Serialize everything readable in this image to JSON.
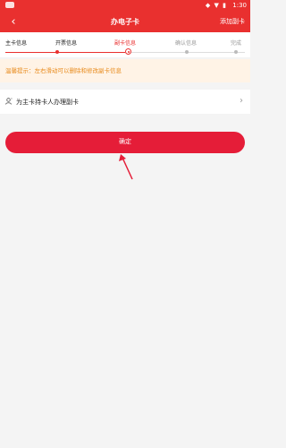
{
  "status_bar": {
    "time": "1:30",
    "icons": "◆ ▼ ▮"
  },
  "header": {
    "back_icon": "‹",
    "title": "办电子卡",
    "action_label": "添加副卡"
  },
  "steps": [
    {
      "label": "主卡信息",
      "state": "done"
    },
    {
      "label": "开票信息",
      "state": "done"
    },
    {
      "label": "副卡信息",
      "state": "current"
    },
    {
      "label": "确认信息",
      "state": "pending"
    },
    {
      "label": "完成",
      "state": "pending"
    }
  ],
  "tip": {
    "text": "温馨提示：左右滑动可以删除和修改副卡信息"
  },
  "add_row": {
    "label": "为主卡持卡人办理副卡",
    "chevron": "›"
  },
  "confirm_button": {
    "label": "确定"
  },
  "colors": {
    "brand_red": "#e9302f",
    "button_red": "#e51d38",
    "tip_bg": "#fff3e6",
    "tip_text": "#e88b1d"
  }
}
